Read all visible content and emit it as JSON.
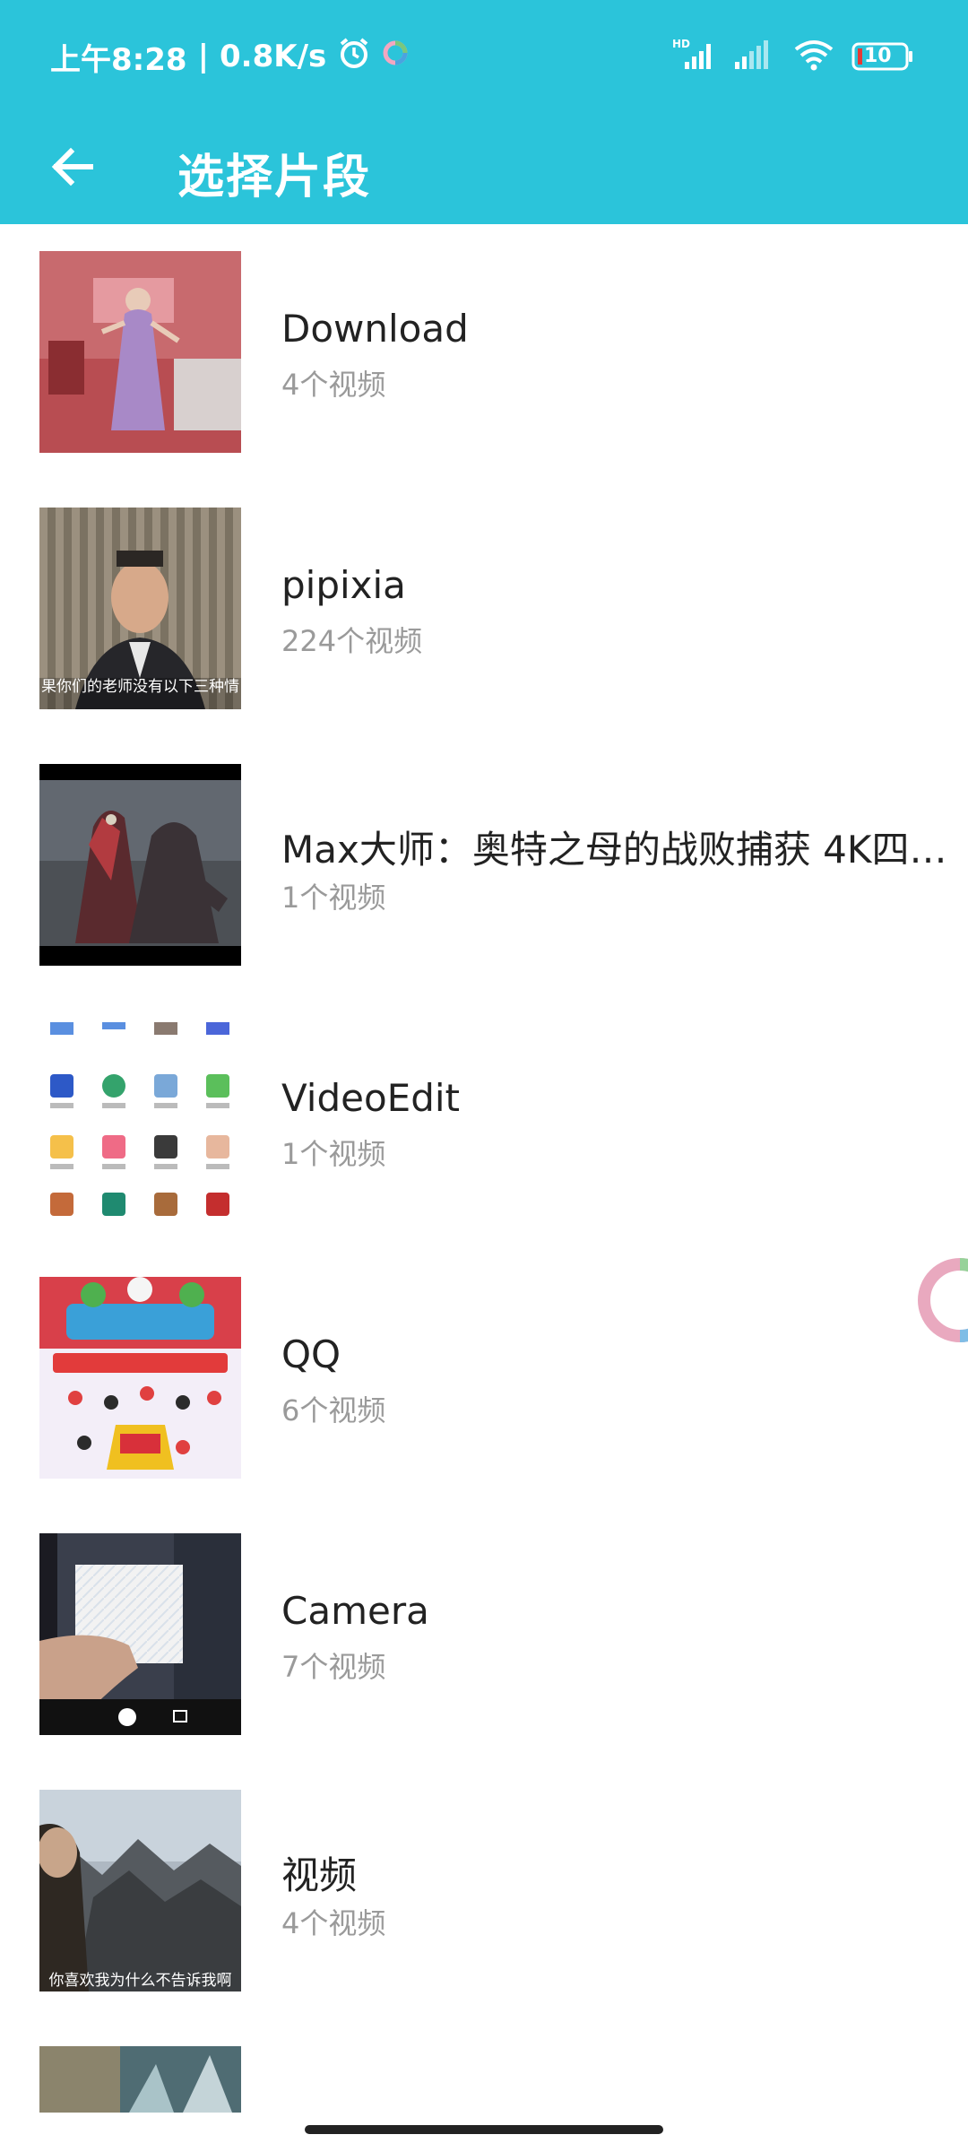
{
  "status_bar": {
    "time": "上午8:28",
    "separator": "|",
    "net_speed": "0.8K/s",
    "battery": "10",
    "icons": [
      "alarm-icon",
      "app-ring-icon",
      "hd-signal-icon",
      "signal-icon",
      "wifi-icon",
      "battery-icon"
    ]
  },
  "toolbar": {
    "back_icon": "back-arrow-icon",
    "title": "选择片段"
  },
  "folders": [
    {
      "name": "Download",
      "count": "4个视频"
    },
    {
      "name": "pipixia",
      "count": "224个视频",
      "thumb_caption": "果你们的老师没有以下三种情"
    },
    {
      "name": "Max大师：奥特之母的战败捕获 4K四…",
      "count": "1个视频"
    },
    {
      "name": "VideoEdit",
      "count": "1个视频"
    },
    {
      "name": "QQ",
      "count": "6个视频"
    },
    {
      "name": "Camera",
      "count": "7个视频"
    },
    {
      "name": "视频",
      "count": "4个视频",
      "thumb_caption": "你喜欢我为什么不告诉我啊"
    },
    {
      "name": "",
      "count": ""
    }
  ],
  "colors": {
    "accent": "#2BC4DA",
    "title_text": "#222222",
    "sub_text": "#9a9a9a"
  }
}
